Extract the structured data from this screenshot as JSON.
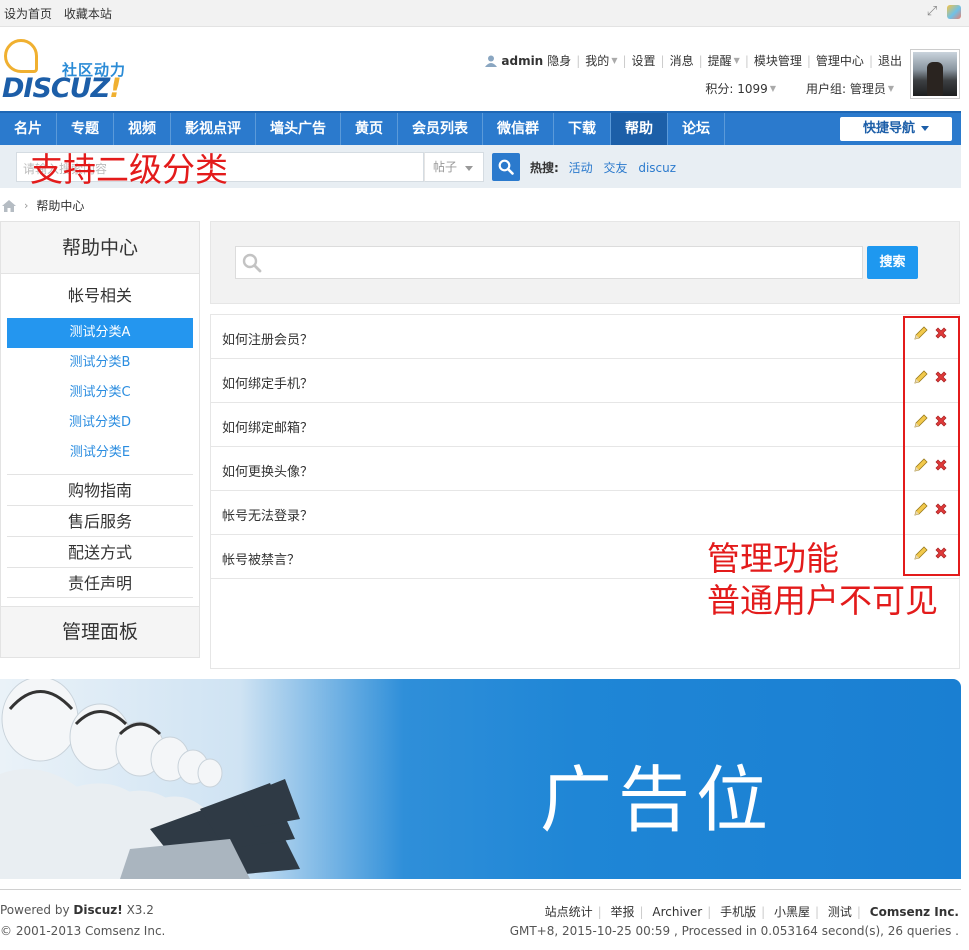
{
  "topbar": {
    "links": [
      "设为首页",
      "收藏本站"
    ]
  },
  "header": {
    "logo": {
      "slogan": "社区动力",
      "brand": "DISCUZ",
      "bang": "!"
    },
    "user": {
      "name": "admin",
      "status": "隐身",
      "links": [
        "我的",
        "设置",
        "消息",
        "提醒",
        "模块管理",
        "管理中心",
        "退出"
      ],
      "points": "积分: 1099",
      "group": "用户组: 管理员"
    }
  },
  "nav": {
    "items": [
      "名片",
      "专题",
      "视频",
      "影视点评",
      "墙头广告",
      "黄页",
      "会员列表",
      "微信群",
      "下载",
      "帮助",
      "论坛"
    ],
    "active": "帮助",
    "quick_nav": "快捷导航"
  },
  "search": {
    "placeholder": "请输入搜索内容",
    "type": "帖子",
    "hot_label": "热搜:",
    "hot_terms": [
      "活动",
      "交友",
      "discuz"
    ]
  },
  "annotations": {
    "sub_category": "支持二级分类",
    "admin_line1": "管理功能",
    "admin_line2": "普通用户不可见"
  },
  "breadcrumb": {
    "current": "帮助中心"
  },
  "sidebar": {
    "title": "帮助中心",
    "category": "帐号相关",
    "subcategories": [
      "测试分类A",
      "测试分类B",
      "测试分类C",
      "测试分类D",
      "测试分类E"
    ],
    "active_sub": "测试分类A",
    "other_categories": [
      "购物指南",
      "售后服务",
      "配送方式",
      "责任声明"
    ],
    "footer": "管理面板"
  },
  "main": {
    "search_button": "搜索",
    "questions": [
      "如何注册会员？",
      "如何绑定手机？",
      "如何绑定邮箱？",
      "如何更换头像？",
      "帐号无法登录？",
      "帐号被禁言？"
    ]
  },
  "banner": {
    "text": "广告位"
  },
  "footer": {
    "powered_prefix": "Powered by",
    "powered_brand": "Discuz!",
    "version": "X3.2",
    "copyright": "© 2001-2013 Comsenz Inc.",
    "links": [
      "站点统计",
      "举报",
      "Archiver",
      "手机版",
      "小黑屋",
      "测试"
    ],
    "company": "Comsenz Inc.",
    "stats": "GMT+8, 2015-10-25 00:59 , Processed in 0.053164 second(s), 26 queries ."
  },
  "colors": {
    "nav_blue": "#2b7acd",
    "active_blue": "#2496ef",
    "annotation_red": "#e31b1b"
  }
}
